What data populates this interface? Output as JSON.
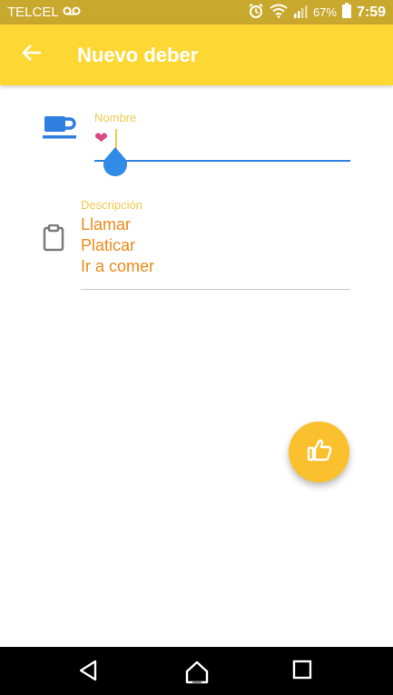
{
  "status_bar": {
    "carrier": "TELCEL",
    "battery": "67%",
    "time": "7:59",
    "icons": [
      "voicemail-icon",
      "alarm-icon",
      "wifi-icon",
      "signal-icon",
      "battery-icon"
    ]
  },
  "app_bar": {
    "title": "Nuevo deber",
    "back_icon": "arrow-back-icon"
  },
  "form": {
    "name": {
      "label": "Nombre",
      "value": "❤",
      "icon": "coffee-cup-icon"
    },
    "description": {
      "label": "Descripción",
      "lines": [
        "Llamar",
        "Platicar",
        "Ir a comer"
      ],
      "icon": "clipboard-icon"
    }
  },
  "fab": {
    "icon": "thumbs-up-icon"
  },
  "nav_bar": {
    "icons": [
      "nav-back-icon",
      "nav-home-icon",
      "nav-recents-icon"
    ]
  },
  "colors": {
    "status_bar": "#c9a82e",
    "app_bar": "#fdd835",
    "accent_blue": "#2f7fe0",
    "label_yellow": "#f2c94c",
    "text_orange": "#ef8a17",
    "fab": "#fbc02d"
  }
}
